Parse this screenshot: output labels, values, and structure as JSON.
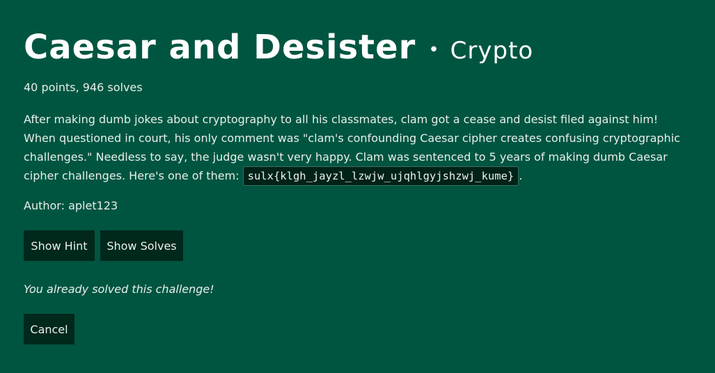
{
  "challenge": {
    "title": "Caesar and Desister",
    "separator": "•",
    "category": "Crypto",
    "meta": "40 points, 946 solves",
    "description_before": "After making dumb jokes about cryptography to all his classmates, clam got a cease and desist filed against him! When questioned in court, his only comment was \"clam's confounding Caesar cipher creates confusing cryptographic challenges.\" Needless to say, the judge wasn't very happy. Clam was sentenced to 5 years of making dumb Caesar cipher challenges. Here's one of them: ",
    "ciphertext": "sulx{klgh_jayzl_lzwjw_ujqhlgyjshzwj_kume}",
    "description_after": ".",
    "author": "Author: aplet123",
    "solved_message": "You already solved this challenge!"
  },
  "buttons": {
    "show_hint": "Show Hint",
    "show_solves": "Show Solves",
    "cancel": "Cancel"
  },
  "colors": {
    "background": "#005541",
    "button_bg": "#00281b",
    "code_bg": "#002217",
    "text": "#e6efea"
  }
}
